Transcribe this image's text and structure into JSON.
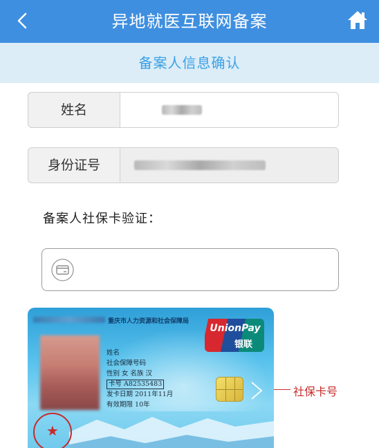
{
  "header": {
    "title": "异地就医互联网备案",
    "back_icon": "chevron-left-icon",
    "home_icon": "home-icon"
  },
  "subheader": {
    "title": "备案人信息确认"
  },
  "form": {
    "name_label": "姓名",
    "id_label": "身份证号",
    "verify_label": "备案人社保卡验证：",
    "card_input_icon": "card-icon"
  },
  "sample_card": {
    "issuer": "重庆市人力资源和社会保障局",
    "brand_en": "UnionPay",
    "brand_cn": "银联",
    "lines": {
      "name": "姓名",
      "ssn": "社会保障号码",
      "gender": "性别 女  名族 汉",
      "card_no": "卡号 A82535483",
      "issue_date": "发卡日期 2011年11月",
      "valid": "有效期限 10年"
    },
    "pointer_label": "社保卡号"
  },
  "colors": {
    "header_bg": "#3f8fe0",
    "subheader_bg": "#dcedf8",
    "subheader_text": "#3aa0e6",
    "pointer": "#c72a2a"
  }
}
